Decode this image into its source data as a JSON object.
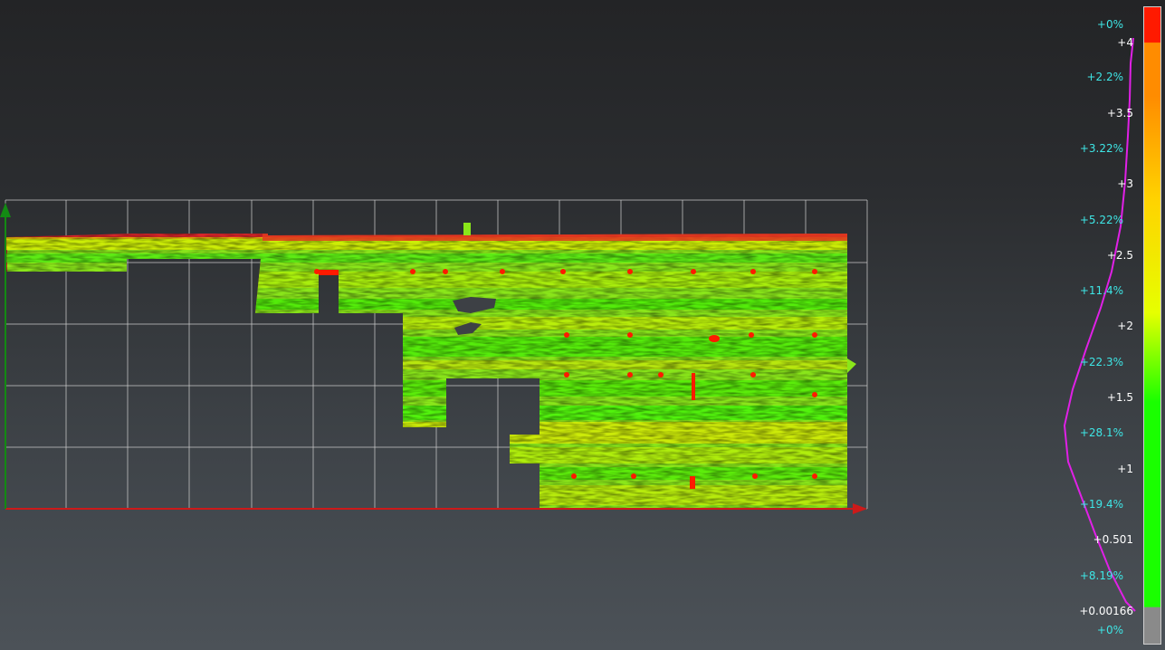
{
  "scale": {
    "value_labels": [
      "+4",
      "+3.5",
      "+3",
      "+2.5",
      "+2",
      "+1.5",
      "+1",
      "+0.501",
      "+0.00166"
    ],
    "percent_labels": [
      "+0%",
      "+2.2%",
      "+3.22%",
      "+5.22%",
      "+11.4%",
      "+22.3%",
      "+28.1%",
      "+19.4%",
      "+8.19%",
      "+0%"
    ],
    "colors": {
      "above_max": "#ff1a00",
      "high": "#ff8c00",
      "mid_high": "#ffd200",
      "mid": "#e6ff00",
      "low": "#1aff00",
      "below_min": "#8a8a8a",
      "histogram": "#e020e6"
    }
  },
  "axes": {
    "x_color": "#cc1a1a",
    "y_color": "#138a13",
    "grid_color": "#c8c8c8"
  }
}
